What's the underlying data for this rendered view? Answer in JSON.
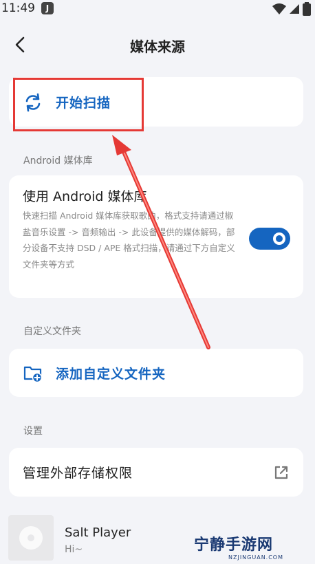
{
  "status_bar": {
    "time": "11:49",
    "app_icon_glyph": "J"
  },
  "app_bar": {
    "title": "媒体来源"
  },
  "scan": {
    "label": "开始扫描"
  },
  "android_section": {
    "label": "Android 媒体库",
    "title": "使用 Android 媒体库",
    "description": "快速扫描 Android 媒体库获取歌曲，格式支持请通过椒盐音乐设置 -> 音频输出 -> 此设备提供的媒体解码，部分设备不支持 DSD / APE 格式扫描，请通过下方自定义文件夹等方式",
    "toggle_on": true
  },
  "custom_section": {
    "label": "自定义文件夹",
    "add_label": "添加自定义文件夹"
  },
  "settings_section": {
    "label": "设置",
    "storage_label": "管理外部存储权限"
  },
  "player": {
    "title": "Salt Player",
    "subtitle": "Hi~"
  },
  "watermark": {
    "main": "宁静手游网",
    "sub": "NZJINGUAN.COM"
  },
  "colors": {
    "accent": "#1565c0",
    "annotation": "#e53935",
    "background": "#f3f4f8"
  }
}
